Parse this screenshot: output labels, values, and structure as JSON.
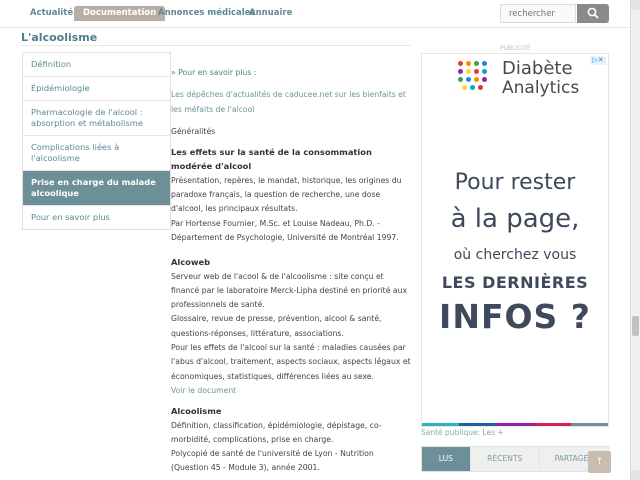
{
  "nav": {
    "items": [
      "Actualité",
      "Documentation",
      "Annonces médicales",
      "Annuaire"
    ],
    "active": "Documentation",
    "search_placeholder": "rechercher"
  },
  "page_title": "L'alcoolisme",
  "sidebar": {
    "items": [
      "Définition",
      "Épidémiologie",
      "Pharmacologie de l'alcool : absorption et métabolisme",
      "Complications liées à l'alcoolisme",
      "Prise en charge du malade alcoolique",
      "Pour en savoir plus"
    ],
    "active_index": 4
  },
  "content": {
    "more_link": "» Pour en savoir plus :",
    "depeches": "Les dépêches d'actualités de caducee.net sur les bienfaits et les méfaits de l'alcool",
    "generalites": "Généralités",
    "s1_title": "Les effets sur la santé de la consommation modérée d'alcool",
    "s1_desc": "Présentation, repères, le mandat, historique, les origines du paradoxe français, la question de recherche, une dose d'alcool, les principaux résultats.",
    "s1_author": "Par Hortense Fournier, M.Sc. et Louise Nadeau, Ph.D. - Département de Psychologie, Université de Montréal 1997.",
    "s2_title": "Alcoweb",
    "s2_desc1": "Serveur web de l'acool & de l'alcoolisme : site conçu et financé par le laboratoire Merck-Lipha destiné en priorité aux professionnels de santé.",
    "s2_desc2": "Glossaire, revue de presse, prévention, alcool & santé, questions-réponses, littérature, associations.",
    "s2_desc3": "Pour les effets de l'alcool sur la santé : maladies causées par l'abus d'alcool, traitement, aspects sociaux, aspects légaux et économiques, statistiques, différences liées au sexe.",
    "s2_link": "Voir le document",
    "s3_title": "Alcoolisme",
    "s3_desc1": "Définition, classification, épidémiologie, dépistage, co-morbidité, complications, prise en charge.",
    "s3_desc2": "Polycopié de santé de l'université de Lyon - Nutrition (Question 45 - Module 3), année 2001."
  },
  "ad": {
    "label": "PUBLICITÉ",
    "brand_line1": "Diabète",
    "brand_line2": "Analytics",
    "line1": "Pour rester",
    "line2": "à la page,",
    "line3": "où cherchez vous",
    "line4": "LES DERNIÈRES",
    "line5": "INFOS ?"
  },
  "sante_publique": "Santé publique: Les +",
  "tabs": [
    "LUS",
    "RÉCENTS",
    "PARTAGÉS"
  ],
  "active_tab": "LUS",
  "colors": {
    "accent": "#6d8f97",
    "link": "#5b8993",
    "nav_active": "#b9aea1",
    "ad_text": "#3e4a5b"
  }
}
